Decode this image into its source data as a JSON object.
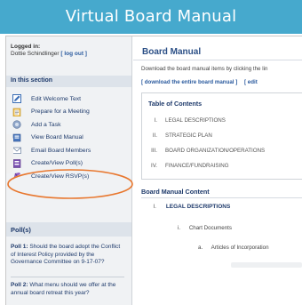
{
  "banner": {
    "title": "Virtual Board Manual"
  },
  "sidebar": {
    "login_label": "Logged in:",
    "user_name": "Dottie Schindlinger",
    "logout_label": "[ log out ]",
    "section_title": "In this section",
    "items": [
      {
        "label": "Edit Welcome Text",
        "icon": "edit-icon"
      },
      {
        "label": "Prepare for a Meeting",
        "icon": "clipboard-icon"
      },
      {
        "label": "Add a Task",
        "icon": "task-icon"
      },
      {
        "label": "View Board Manual",
        "icon": "book-icon"
      },
      {
        "label": "Email Board Members",
        "icon": "envelope-icon"
      },
      {
        "label": "Create/View Poll(s)",
        "icon": "poll-icon"
      },
      {
        "label": "Create/View RSVP(s)",
        "icon": "rsvp-icon"
      }
    ],
    "polls_title": "Poll(s)",
    "polls": [
      {
        "number": "Poll 1:",
        "text": "Should the board adopt the Conflict of Interest Policy provided by the Governance Committee on 9-17-07?"
      },
      {
        "number": "Poll 2:",
        "text": "What menu should we offer at the annual board retreat this year?"
      }
    ]
  },
  "main": {
    "title": "Board Manual",
    "description": "Download the board manual items by clicking the lin",
    "links": [
      "[ download the entire board manual ]",
      "[ edit"
    ],
    "toc": {
      "heading": "Table of Contents",
      "items": [
        {
          "num": "I.",
          "label": "LEGAL DESCRIPTIONS"
        },
        {
          "num": "II.",
          "label": "STRATEGIC PLAN"
        },
        {
          "num": "III.",
          "label": "BOARD ORGANIZATION/OPERATIONS"
        },
        {
          "num": "IV.",
          "label": "FINANCE/FUNDRAISING"
        }
      ]
    },
    "content": {
      "heading": "Board Manual Content",
      "section_num": "I.",
      "section_label": "LEGAL DESCRIPTIONS",
      "sub_num": "i.",
      "sub_label": "Chart Documents",
      "subsub_num": "a.",
      "subsub_label": "Articles of Incorporation"
    }
  },
  "colors": {
    "banner": "#46a9cd",
    "highlight": "#e8772e",
    "link": "#2a5a9e"
  }
}
